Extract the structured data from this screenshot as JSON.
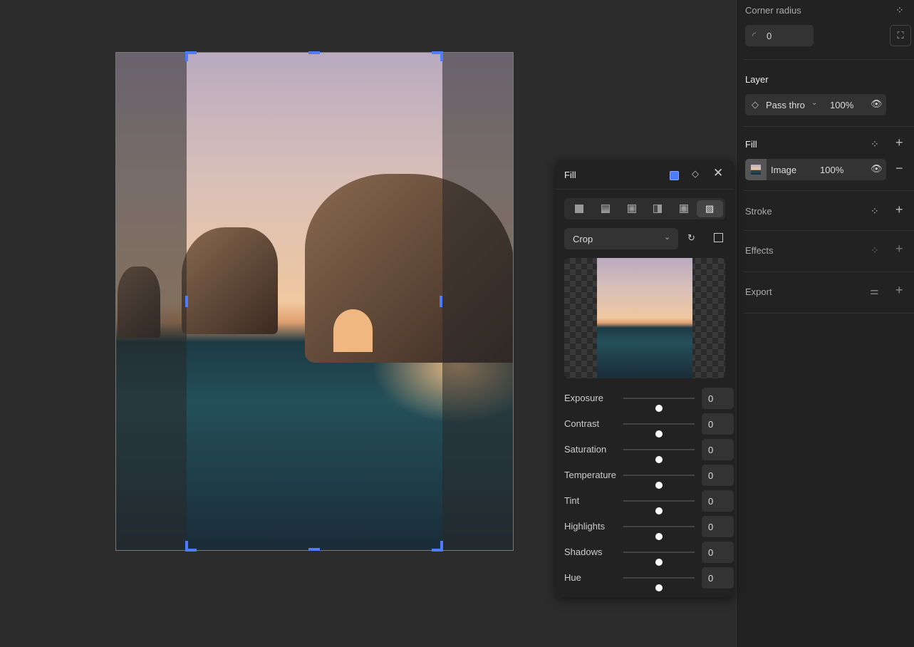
{
  "panel": {
    "corner_radius": {
      "label": "Corner radius",
      "value": "0"
    },
    "layer": {
      "label": "Layer",
      "blend": "Pass thro",
      "opacity": "100%"
    },
    "fill": {
      "label": "Fill",
      "type": "Image",
      "opacity": "100%"
    },
    "stroke": {
      "label": "Stroke"
    },
    "effects": {
      "label": "Effects"
    },
    "export": {
      "label": "Export"
    }
  },
  "fill_popup": {
    "title": "Fill",
    "mode": "Crop",
    "accent": "#4d7cfe",
    "adjustments": [
      {
        "label": "Exposure",
        "value": "0",
        "level": 0.5
      },
      {
        "label": "Contrast",
        "value": "0",
        "level": 0.5
      },
      {
        "label": "Saturation",
        "value": "0",
        "level": 0.5
      },
      {
        "label": "Temperature",
        "value": "0",
        "level": 0.5
      },
      {
        "label": "Tint",
        "value": "0",
        "level": 0.5
      },
      {
        "label": "Highlights",
        "value": "0",
        "level": 0.5
      },
      {
        "label": "Shadows",
        "value": "0",
        "level": 0.5
      },
      {
        "label": "Hue",
        "value": "0",
        "level": 0.5
      }
    ]
  }
}
